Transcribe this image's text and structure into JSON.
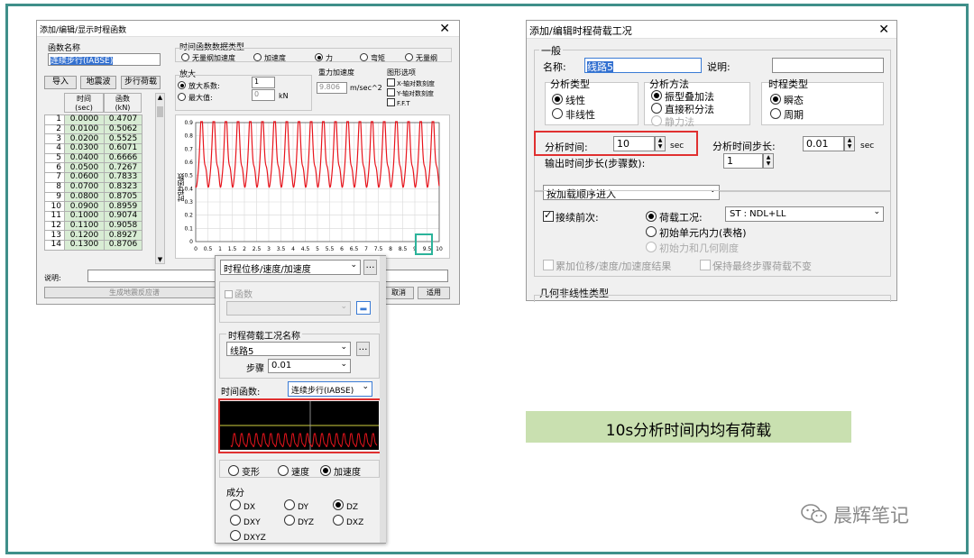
{
  "left_dialog": {
    "title": "添加/编辑/显示时程函数",
    "func_name_label": "函数名称",
    "func_name_value": "连续步行(IABSE)",
    "buttons": {
      "import": "导入",
      "earthquake": "地震波",
      "walking": "步行荷载"
    },
    "table_headers": {
      "time": "时间",
      "time_unit": "(sec)",
      "func": "函数",
      "func_unit": "(kN)"
    },
    "rows": [
      [
        "1",
        "0.0000",
        "0.4707"
      ],
      [
        "2",
        "0.0100",
        "0.5062"
      ],
      [
        "3",
        "0.0200",
        "0.5525"
      ],
      [
        "4",
        "0.0300",
        "0.6071"
      ],
      [
        "5",
        "0.0400",
        "0.6666"
      ],
      [
        "6",
        "0.0500",
        "0.7267"
      ],
      [
        "7",
        "0.0600",
        "0.7833"
      ],
      [
        "8",
        "0.0700",
        "0.8323"
      ],
      [
        "9",
        "0.0800",
        "0.8705"
      ],
      [
        "10",
        "0.0900",
        "0.8959"
      ],
      [
        "11",
        "0.1000",
        "0.9074"
      ],
      [
        "12",
        "0.1100",
        "0.9058"
      ],
      [
        "13",
        "0.1200",
        "0.8927"
      ],
      [
        "14",
        "0.1300",
        "0.8706"
      ]
    ],
    "data_type_group": "时间函数数据类型",
    "data_types": [
      "无量纲加速度",
      "加速度",
      "力",
      "弯矩",
      "无量纲"
    ],
    "scale_group": "放大",
    "scale_factor_label": "放大系数:",
    "scale_factor_value": "1",
    "max_label": "最大值:",
    "max_value": "0",
    "max_unit": "kN",
    "gravity_label": "重力加速度",
    "gravity_value": "9.806",
    "gravity_unit": "m/sec^2",
    "graph_options_label": "图形选项",
    "graph_options": [
      "X-轴对数刻度",
      "Y-轴对数刻度",
      "F.F.T"
    ],
    "y_axis_label": "时程函数",
    "desc_label": "说明:",
    "bottom_button": "生成地震反应谱",
    "cancel": "取消",
    "apply": "适用"
  },
  "chart_data": {
    "type": "line",
    "title": "",
    "xlabel": "",
    "ylabel": "时程函数",
    "xlim": [
      0,
      10
    ],
    "ylim": [
      0,
      0.9
    ],
    "xticks": [
      "0",
      "0.5",
      "1",
      "1.5",
      "2",
      "2.5",
      "3",
      "3.5",
      "4",
      "4.5",
      "5",
      "5.5",
      "6",
      "6.5",
      "7",
      "7.5",
      "8",
      "8.5",
      "9",
      "9.5",
      "10"
    ],
    "yticks": [
      "0",
      "0.1",
      "0.2",
      "0.3",
      "0.4",
      "0.5",
      "0.6",
      "0.7",
      "0.8",
      "0.9"
    ],
    "cycles": 20,
    "peak": 0.907,
    "trough": 0.37,
    "series_color": "#e8141c",
    "grid": true
  },
  "mid_panel": {
    "dropdown": "时程位移/速度/加速度",
    "func_check": "函数",
    "load_case_group": "时程荷载工况名称",
    "load_case_value": "线路5",
    "step_label": "步骤",
    "step_value": "0.01",
    "time_func_label": "时间函数:",
    "time_func_value": "连续步行(IABSE)",
    "response_types": [
      "变形",
      "速度",
      "加速度"
    ],
    "component_label": "成分",
    "components": [
      "DX",
      "DY",
      "DZ",
      "DXY",
      "DYZ",
      "DXZ",
      "DXYZ"
    ]
  },
  "right_dialog": {
    "title": "添加/编辑时程荷载工况",
    "general": "一般",
    "name_label": "名称:",
    "name_value": "线路5",
    "desc_label": "说明:",
    "analysis_type_label": "分析类型",
    "analysis_types": [
      "线性",
      "非线性"
    ],
    "analysis_method_label": "分析方法",
    "analysis_methods": [
      "振型叠加法",
      "直接积分法",
      "静力法"
    ],
    "history_type_label": "时程类型",
    "history_types": [
      "瞬态",
      "周期"
    ],
    "analysis_time_label": "分析时间:",
    "analysis_time_value": "10",
    "time_unit": "sec",
    "step_label": "分析时间步长:",
    "step_value": "0.01",
    "output_step_label": "输出时间步长(步骤数):",
    "output_step_value": "1",
    "order_value": "按加载顺序进入",
    "continue_label": "接续前次:",
    "load_case_radio": "荷载工况:",
    "load_case_value": "ST : NDL+LL",
    "init_force_table": "初始单元内力(表格)",
    "init_force_stiff": "初始力和几何刚度",
    "accum_label": "累加位移/速度/加速度结果",
    "keep_label": "保持最终步骤荷载不变",
    "geo_nonlinear": "几何非线性类型"
  },
  "caption": "10s分析时间内均有荷载",
  "watermark": "晨辉笔记"
}
